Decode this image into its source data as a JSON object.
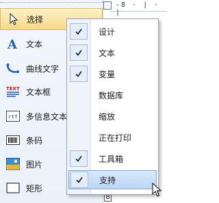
{
  "toolbox": {
    "items": [
      {
        "label": "选择",
        "icon": "arrow-cursor-icon",
        "selected": true
      },
      {
        "label": "文本",
        "icon": "text-a-icon"
      },
      {
        "label": "曲线文字",
        "icon": "curved-text-icon"
      },
      {
        "label": "文本框",
        "icon": "text-box-icon"
      },
      {
        "label": "多信息文本",
        "icon": "rich-text-icon"
      },
      {
        "label": "条码",
        "icon": "barcode-icon"
      },
      {
        "label": "图片",
        "icon": "picture-icon"
      },
      {
        "label": "矩形",
        "icon": "rectangle-icon"
      }
    ]
  },
  "ruler": {
    "text": "-8 · | · |"
  },
  "vruler": {
    "number": "8"
  },
  "context_menu": {
    "items": [
      {
        "label": "设计",
        "checked": true
      },
      {
        "label": "文本",
        "checked": true
      },
      {
        "label": "变量",
        "checked": true
      },
      {
        "label": "数据库",
        "checked": false
      },
      {
        "label": "缩放",
        "checked": false
      },
      {
        "label": "正在打印",
        "checked": false
      },
      {
        "label": "工具箱",
        "checked": true
      },
      {
        "label": "支持",
        "checked": true,
        "highlighted": true
      }
    ]
  },
  "icons": {
    "check": "checkmark-icon",
    "cursor": "mouse-pointer-icon"
  },
  "colors": {
    "highlight": "#bcd6f6",
    "selected_tool": "#f7d98a",
    "icon_blue": "#1f5fb0"
  }
}
